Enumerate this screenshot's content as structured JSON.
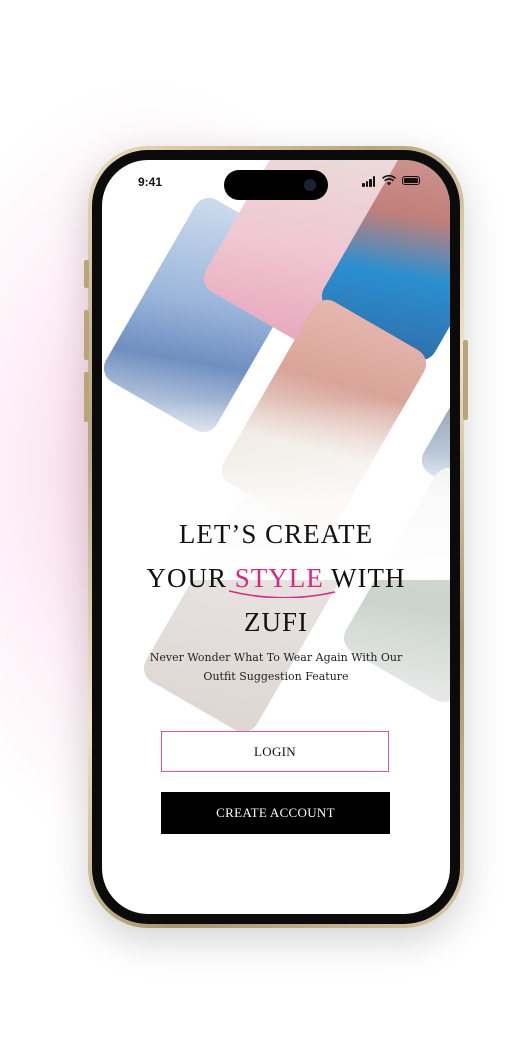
{
  "status_bar": {
    "time": "9:41"
  },
  "headline": {
    "line1": "LET’S CREATE",
    "line2_before": "YOUR ",
    "line2_accent": "STYLE",
    "line2_after": " WITH",
    "line3": "ZUFI"
  },
  "subtitle": {
    "line1": "Never Wonder What To Wear Again With Our",
    "line2": "Outfit Suggestion Feature"
  },
  "buttons": {
    "login": "LOGIN",
    "create_account": "CREATE ACCOUNT"
  },
  "colors": {
    "accent": "#d42a83",
    "login_border": "#e0529b",
    "primary_button": "#000000",
    "background_glow": "#f6c4de",
    "phone_frame": "#b9a57c"
  },
  "icons": {
    "signal": "cellular-signal-icon",
    "wifi": "wifi-icon",
    "battery": "battery-icon"
  }
}
